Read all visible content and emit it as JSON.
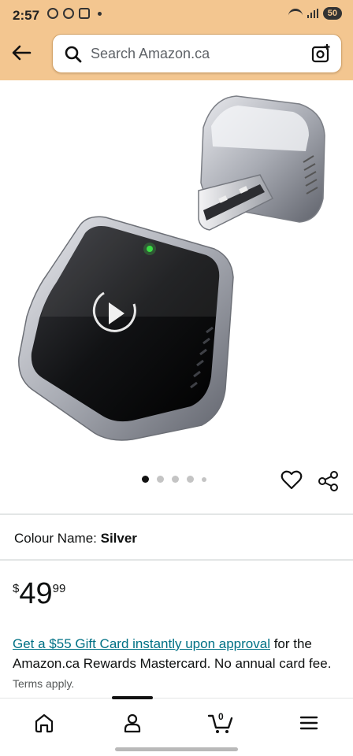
{
  "status_bar": {
    "time": "2:57",
    "battery": "50"
  },
  "header": {
    "search_placeholder": "Search Amazon.ca"
  },
  "gallery": {
    "image_count": 5,
    "active_index": 0
  },
  "product": {
    "colour_label": "Colour Name:",
    "colour_value": "Silver",
    "price_symbol": "$",
    "price_whole": "49",
    "price_fraction": "99"
  },
  "promo": {
    "link_text": "Get a $55 Gift Card instantly upon approval",
    "body_text": " for the Amazon.ca Rewards Mastercard. No annual card fee. ",
    "terms_text": "Terms apply."
  },
  "bottom_nav": {
    "cart_count": "0"
  },
  "colors": {
    "header_bg": "#f3c690",
    "link": "#007185"
  }
}
